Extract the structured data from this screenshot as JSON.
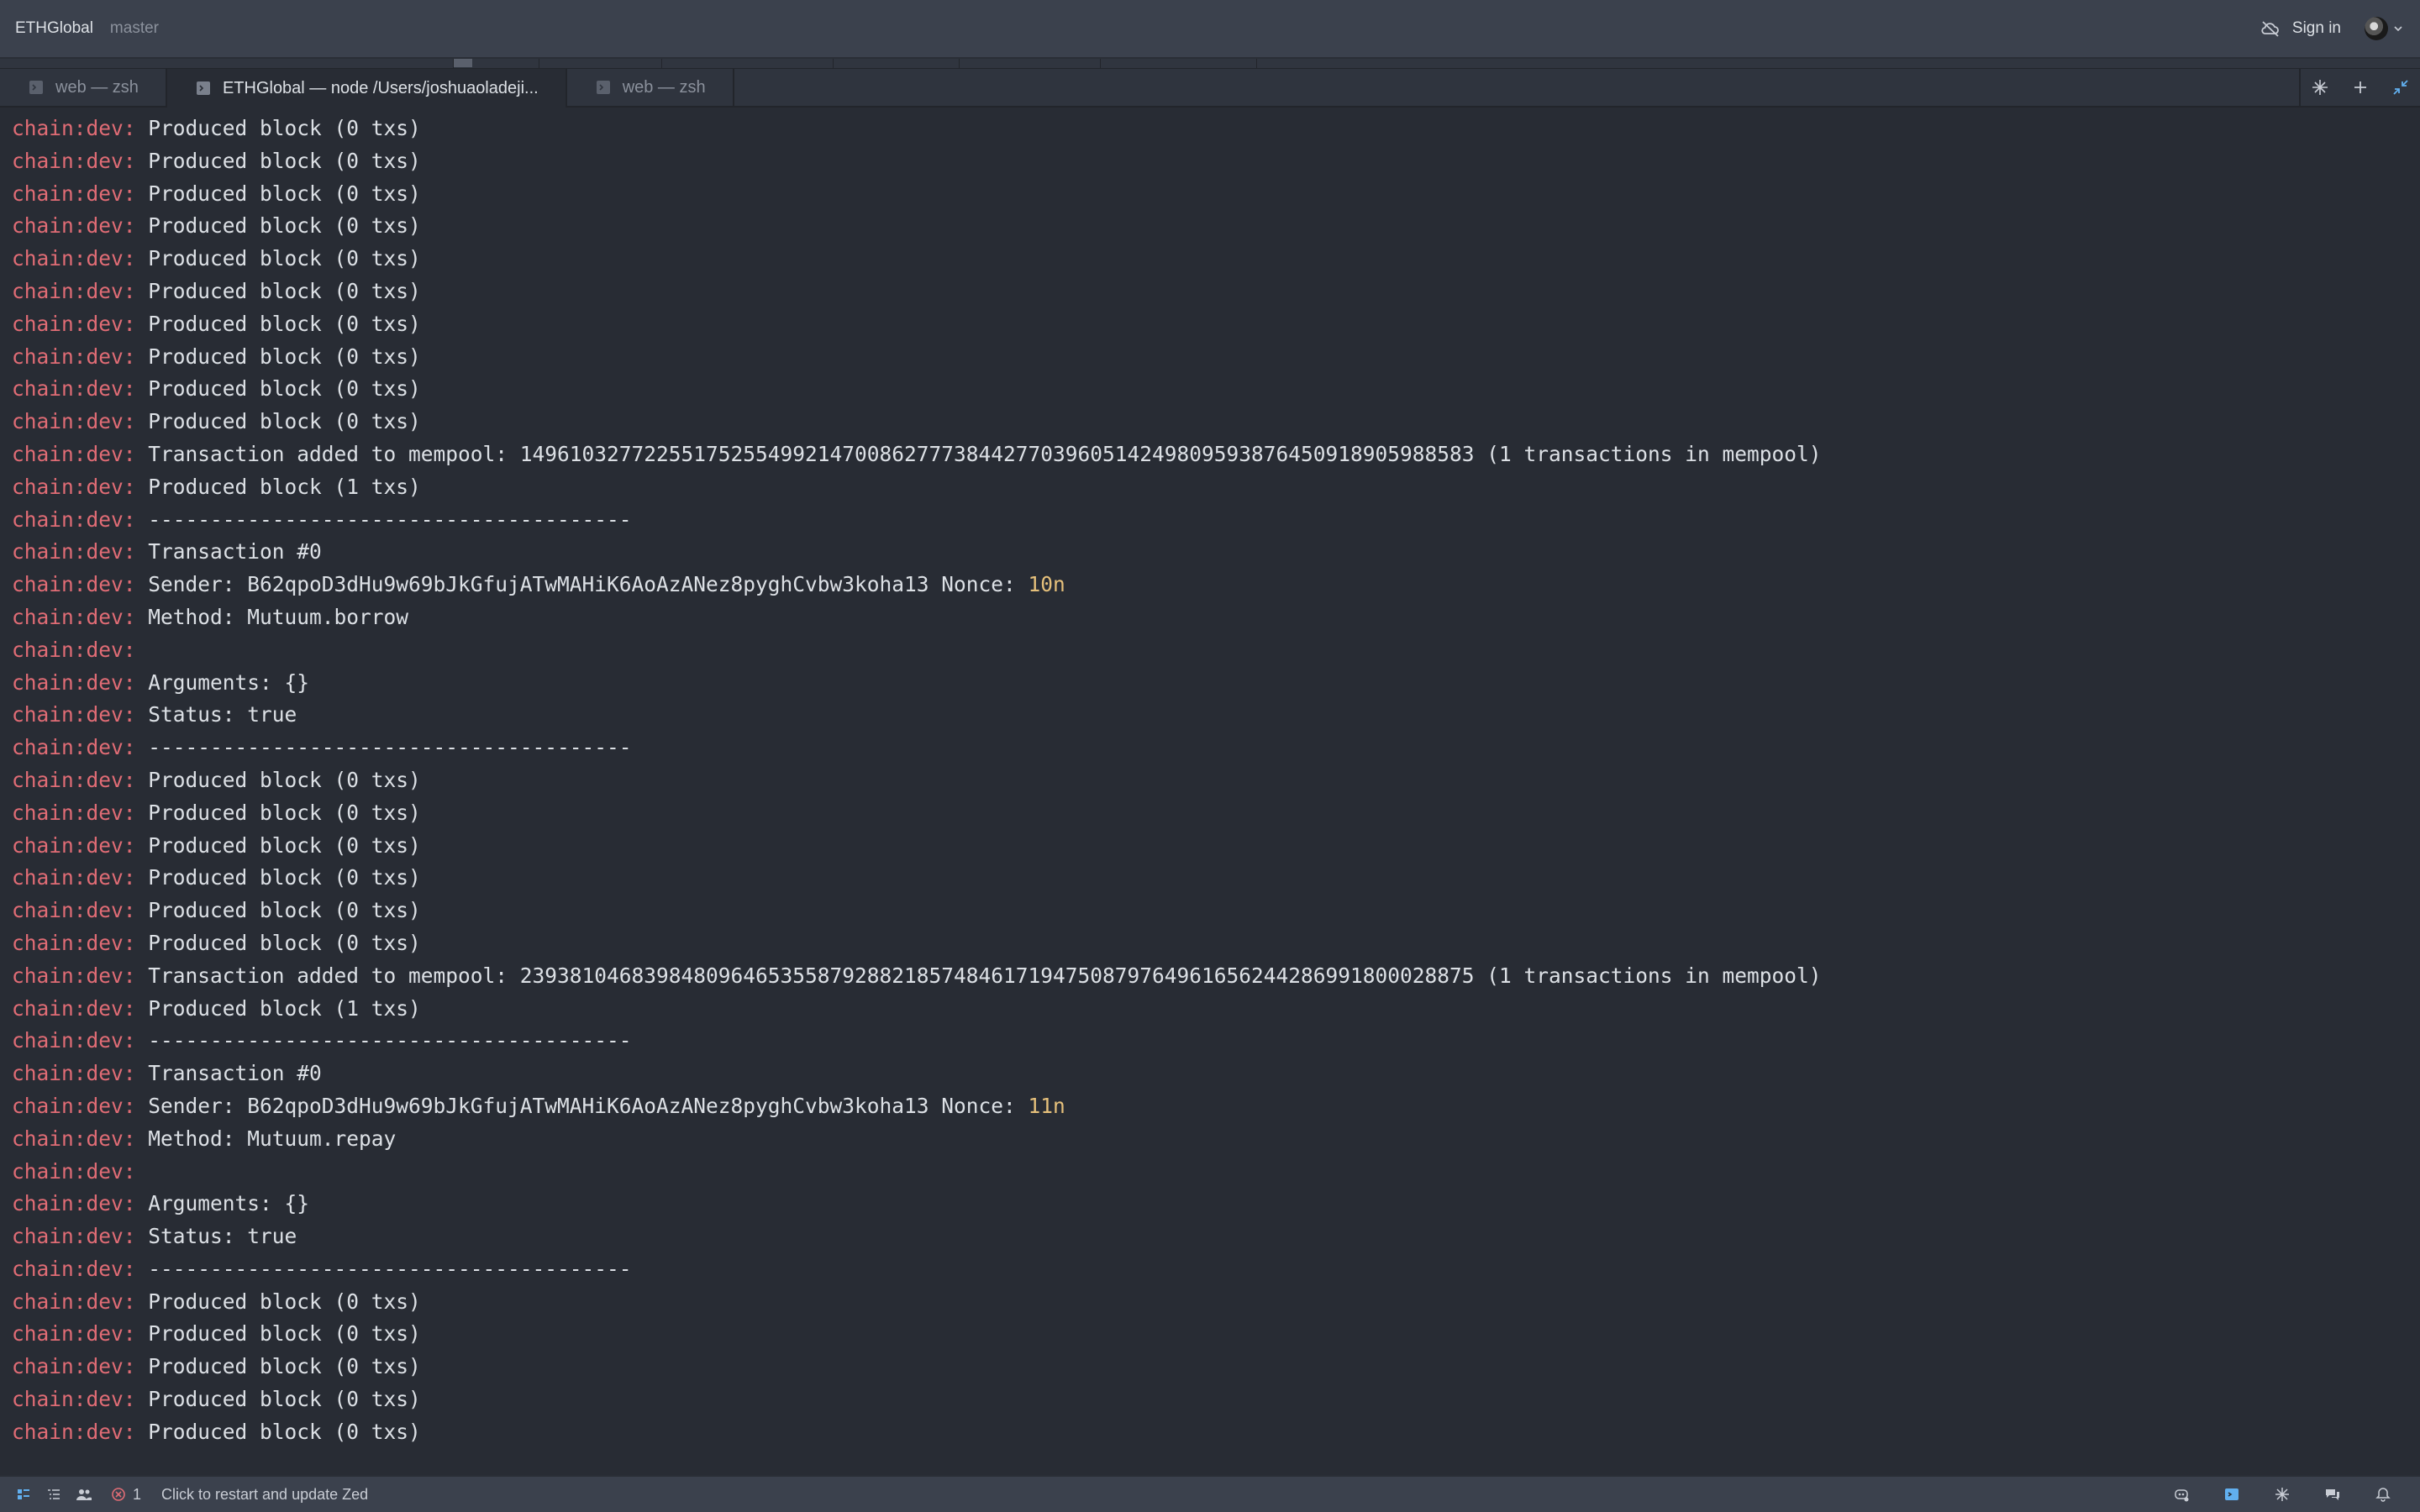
{
  "titlebar": {
    "project": "ETHGlobal",
    "branch": "master",
    "sign_in": "Sign in"
  },
  "tabs": [
    {
      "label": "web — zsh",
      "active": false
    },
    {
      "label": "ETHGlobal — node /Users/joshuaoladeji...",
      "active": true
    },
    {
      "label": "web — zsh",
      "active": false
    }
  ],
  "colors": {
    "prefix": "#e06c75",
    "highlight": "#e5c07b",
    "text": "#dce0e5",
    "background": "#282c34"
  },
  "terminal": {
    "prefix": "chain:dev:",
    "lines": [
      {
        "text": " Produced block (0 txs)"
      },
      {
        "text": " Produced block (0 txs)"
      },
      {
        "text": " Produced block (0 txs)"
      },
      {
        "text": " Produced block (0 txs)"
      },
      {
        "text": " Produced block (0 txs)"
      },
      {
        "text": " Produced block (0 txs)"
      },
      {
        "text": " Produced block (0 txs)"
      },
      {
        "text": " Produced block (0 txs)"
      },
      {
        "text": " Produced block (0 txs)"
      },
      {
        "text": " Produced block (0 txs)"
      },
      {
        "text": " Transaction added to mempool: 14961032772255175255499214700862777384427703960514249809593876450918905988583 (1 transactions in mempool)"
      },
      {
        "text": " Produced block (1 txs)"
      },
      {
        "text": " ---------------------------------------"
      },
      {
        "text": " Transaction #0"
      },
      {
        "text": " Sender: B62qpoD3dHu9w69bJkGfujATwMAHiK6AoAzANez8pyghCvbw3koha13 Nonce: ",
        "highlight": "10n"
      },
      {
        "text": " Method: Mutuum.borrow"
      },
      {
        "text": ""
      },
      {
        "text": " Arguments: {}"
      },
      {
        "text": " Status: true"
      },
      {
        "text": " ---------------------------------------"
      },
      {
        "text": " Produced block (0 txs)"
      },
      {
        "text": " Produced block (0 txs)"
      },
      {
        "text": " Produced block (0 txs)"
      },
      {
        "text": " Produced block (0 txs)"
      },
      {
        "text": " Produced block (0 txs)"
      },
      {
        "text": " Produced block (0 txs)"
      },
      {
        "text": " Transaction added to mempool: 23938104683984809646535587928821857484617194750879764961656244286991800028875 (1 transactions in mempool)"
      },
      {
        "text": " Produced block (1 txs)"
      },
      {
        "text": " ---------------------------------------"
      },
      {
        "text": " Transaction #0"
      },
      {
        "text": " Sender: B62qpoD3dHu9w69bJkGfujATwMAHiK6AoAzANez8pyghCvbw3koha13 Nonce: ",
        "highlight": "11n"
      },
      {
        "text": " Method: Mutuum.repay"
      },
      {
        "text": ""
      },
      {
        "text": " Arguments: {}"
      },
      {
        "text": " Status: true"
      },
      {
        "text": " ---------------------------------------"
      },
      {
        "text": " Produced block (0 txs)"
      },
      {
        "text": " Produced block (0 txs)"
      },
      {
        "text": " Produced block (0 txs)"
      },
      {
        "text": " Produced block (0 txs)"
      },
      {
        "text": " Produced block (0 txs)"
      }
    ]
  },
  "statusbar": {
    "error_count": "1",
    "message": "Click to restart and update Zed"
  },
  "icons": {
    "titlebar": [
      "cloud-off-icon",
      "avatar",
      "chevron-down-icon"
    ],
    "tab": "terminal-icon",
    "tab_tools": [
      "sparkle-icon",
      "plus-icon",
      "minimize-icon"
    ],
    "status_left": [
      "project-panel-icon",
      "outline-icon",
      "collab-icon",
      "error-icon"
    ],
    "status_right": [
      "copilot-icon",
      "terminal-panel-icon",
      "assistant-icon",
      "chat-icon",
      "bell-icon"
    ]
  }
}
